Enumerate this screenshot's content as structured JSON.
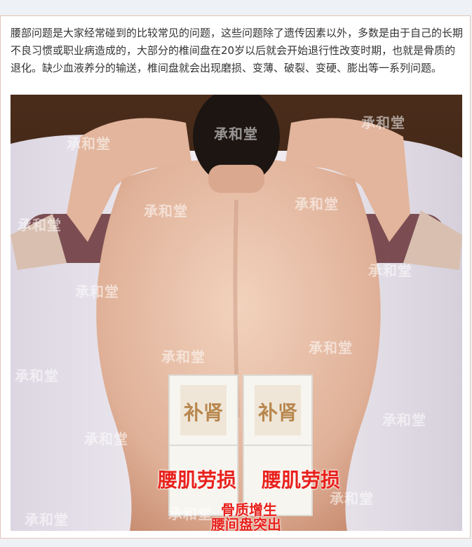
{
  "article": {
    "paragraph": "腰部问题是大家经常碰到的比较常见的问题，这些问题除了遗传因素以外，多数是由于自己的长期不良习惯或职业病造成的，大部分的椎间盘在20岁以后就会开始退行性改变时期，也就是骨质的退化。缺少血液养分的输送，椎间盘就会出现磨损、变薄、破裂、变硬、膨出等一系列问题。"
  },
  "photo": {
    "watermark": "承和堂",
    "patches": [
      "补肾",
      "补肾"
    ],
    "labels": [
      "腰肌劳损",
      "腰肌劳损",
      "骨质增生",
      "腰间盘突出"
    ]
  },
  "colors": {
    "border": "#e2c6b8",
    "text": "#333333",
    "label_red": "#e8211c",
    "patch_text": "#b8874e"
  }
}
